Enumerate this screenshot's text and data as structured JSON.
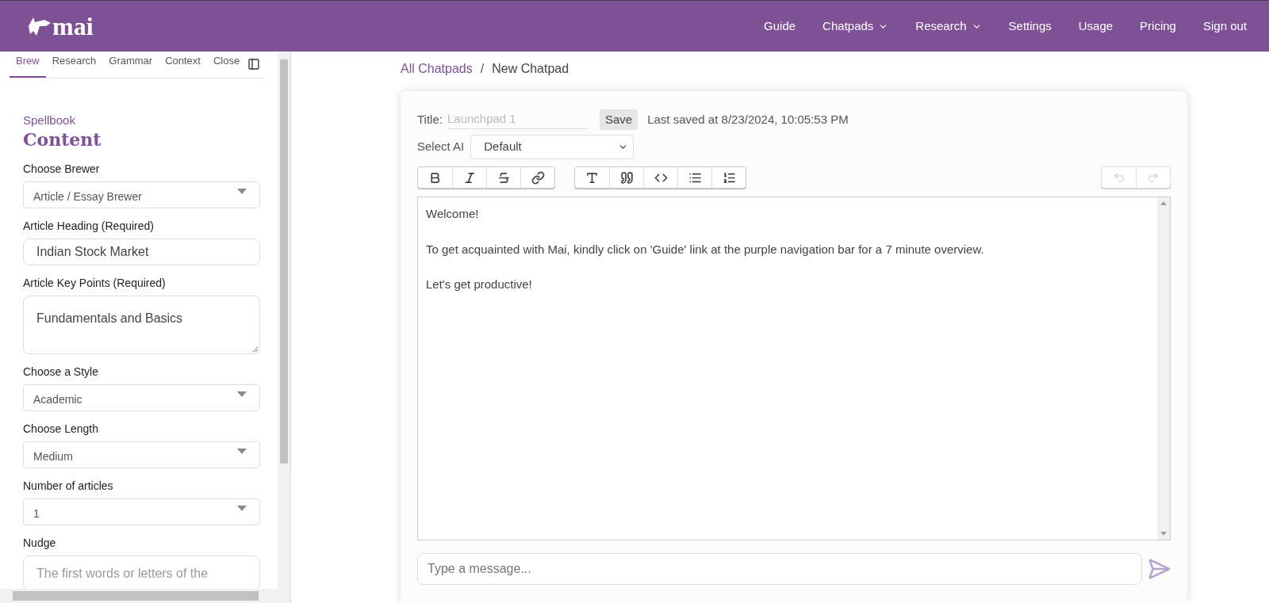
{
  "navbar": {
    "logo": "mai",
    "links": [
      {
        "label": "Guide",
        "dropdown": false
      },
      {
        "label": "Chatpads",
        "dropdown": true
      },
      {
        "label": "Research",
        "dropdown": true
      },
      {
        "label": "Settings",
        "dropdown": false
      },
      {
        "label": "Usage",
        "dropdown": false
      },
      {
        "label": "Pricing",
        "dropdown": false
      },
      {
        "label": "Sign out",
        "dropdown": false
      }
    ]
  },
  "sidebar": {
    "tabs": [
      {
        "label": "Brew",
        "selected": true
      },
      {
        "label": "Research",
        "selected": false
      },
      {
        "label": "Grammar",
        "selected": false
      },
      {
        "label": "Context",
        "selected": false
      },
      {
        "label": "Close",
        "selected": false
      }
    ],
    "eyebrow": "Spellbook",
    "heading": "Content",
    "fields": [
      {
        "kind": "select",
        "label": "Choose Brewer",
        "value": "Article / Essay Brewer"
      },
      {
        "kind": "input",
        "label": "Article Heading (Required)",
        "value": "Indian Stock Market"
      },
      {
        "kind": "textarea",
        "label": "Article Key Points (Required)",
        "value": "Fundamentals and Basics"
      },
      {
        "kind": "select",
        "label": "Choose a Style",
        "value": "Academic"
      },
      {
        "kind": "select",
        "label": "Choose Length",
        "value": "Medium"
      },
      {
        "kind": "select",
        "label": "Number of articles",
        "value": "1"
      },
      {
        "kind": "textarea",
        "label": "Nudge",
        "placeholder": "The first words or letters of the"
      }
    ]
  },
  "breadcrumb": {
    "separator": "/",
    "items": [
      {
        "label": "All Chatpads",
        "link": true
      },
      {
        "label": "New Chatpad",
        "link": false
      }
    ]
  },
  "chatpad": {
    "title_label": "Title:",
    "title_placeholder": "Launchpad 1",
    "save": "Save",
    "last_saved": "Last saved at 8/23/2024, 10:05:53 PM",
    "ai_label": "Select AI",
    "ai_value": "Default",
    "toolbar": [
      [
        {
          "kind": "bold"
        },
        {
          "kind": "italic"
        },
        {
          "kind": "strike"
        },
        {
          "kind": "link"
        }
      ],
      [
        {
          "kind": "heading"
        },
        {
          "kind": "quote"
        },
        {
          "kind": "code"
        },
        {
          "kind": "bullets"
        },
        {
          "kind": "numbers"
        }
      ]
    ],
    "history": [
      {
        "kind": "undo",
        "disabled": true
      },
      {
        "kind": "redo",
        "disabled": true
      }
    ],
    "content": [
      "Welcome!",
      "To get acquainted with Mai, kindly click on 'Guide' link at the purple navigation bar for a 7 minute overview.",
      "Let's get productive!"
    ],
    "message_placeholder": "Type a message..."
  }
}
